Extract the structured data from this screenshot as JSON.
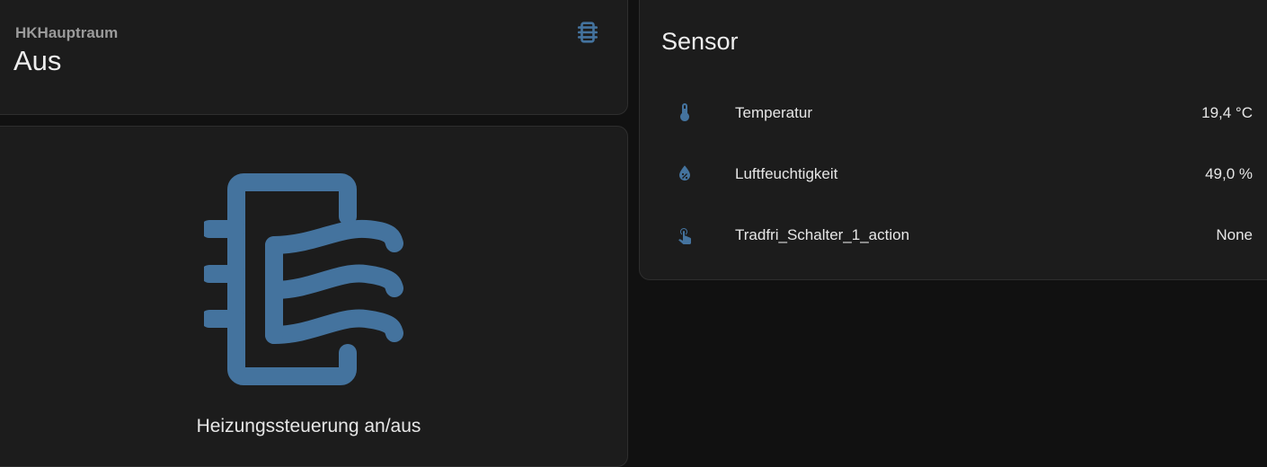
{
  "entity": {
    "name": "HKHauptraum",
    "state": "Aus",
    "icon": "radiator-icon"
  },
  "button": {
    "label": "Heizungssteuerung an/aus",
    "icon": "radiator-icon"
  },
  "sensor": {
    "title": "Sensor",
    "rows": [
      {
        "icon": "thermometer-icon",
        "name": "Temperatur",
        "value": "19,4 °C"
      },
      {
        "icon": "water-percent-icon",
        "name": "Luftfeuchtigkeit",
        "value": "49,0 %"
      },
      {
        "icon": "gesture-tap-icon",
        "name": "Tradfri_Schalter_1_action",
        "value": "None"
      }
    ]
  },
  "colors": {
    "accent": "#44739e",
    "card_bg": "#1c1c1c",
    "page_bg": "#111111"
  }
}
